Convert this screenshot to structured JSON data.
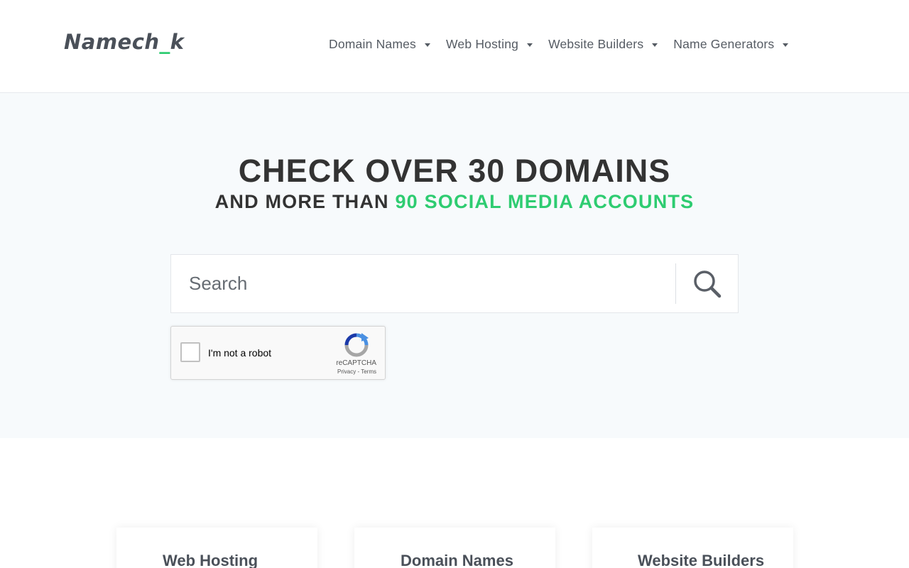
{
  "header": {
    "logo_part1": "Namech",
    "logo_part2": "_",
    "logo_part3": "k",
    "nav": [
      {
        "label": "Domain Names"
      },
      {
        "label": "Web Hosting"
      },
      {
        "label": "Website Builders"
      },
      {
        "label": "Name Generators"
      }
    ]
  },
  "hero": {
    "headline_light": "CHECK OVER ",
    "headline_bold": "30 DOMAINS",
    "subline_plain": "AND MORE THAN ",
    "subline_accent": "90 SOCIAL MEDIA ACCOUNTS",
    "search": {
      "placeholder": "Search",
      "value": "",
      "icon": "search-icon"
    },
    "captcha": {
      "label": "I'm not a robot",
      "brand": "reCAPTCHA",
      "links": "Privacy - Terms",
      "checked": false
    }
  },
  "cards": [
    {
      "title": "Web Hosting"
    },
    {
      "title": "Domain Names"
    },
    {
      "title": "Website Builders"
    }
  ],
  "colors": {
    "accent": "#2ecc71",
    "text": "#333333",
    "hero_bg": "#f7fafc",
    "nav_text": "#555b63"
  }
}
